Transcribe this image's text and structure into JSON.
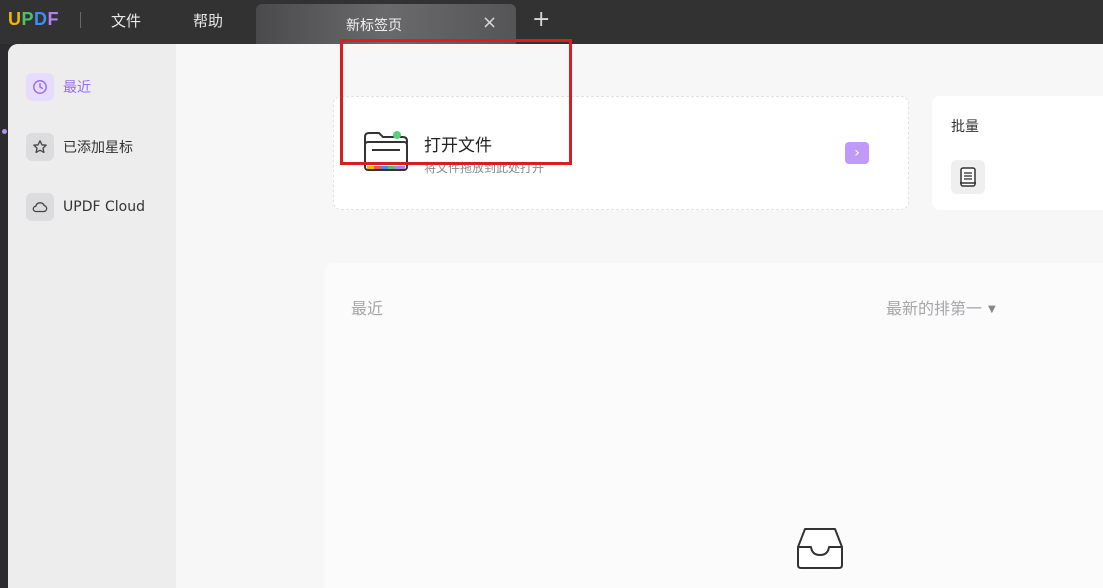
{
  "app": {
    "logo_letters": [
      {
        "char": "U",
        "color": "#f5b400"
      },
      {
        "char": "P",
        "color": "#4cc36a"
      },
      {
        "char": "D",
        "color": "#3d8ef0"
      },
      {
        "char": "F",
        "color": "#b57ef5"
      }
    ]
  },
  "menu": {
    "file": "文件",
    "help": "帮助"
  },
  "tabs": [
    {
      "label": "新标签页",
      "close_icon": "×"
    }
  ],
  "tab_add": "+",
  "sidebar": {
    "items": [
      {
        "label": "最近",
        "icon": "clock-icon",
        "active": true
      },
      {
        "label": "已添加星标",
        "icon": "star-icon",
        "active": false
      },
      {
        "label": "UPDF Cloud",
        "icon": "cloud-icon",
        "active": false
      }
    ]
  },
  "open_file": {
    "title": "打开文件",
    "subtitle": "将文件拖放到此处打开",
    "arrow": "›"
  },
  "batch": {
    "title": "批量"
  },
  "recent": {
    "title": "最近",
    "sort_label": "最新的排第一",
    "sort_caret": "▼"
  },
  "colors": {
    "accent": "#9b6cf0",
    "highlight_box": "#d81e24"
  }
}
